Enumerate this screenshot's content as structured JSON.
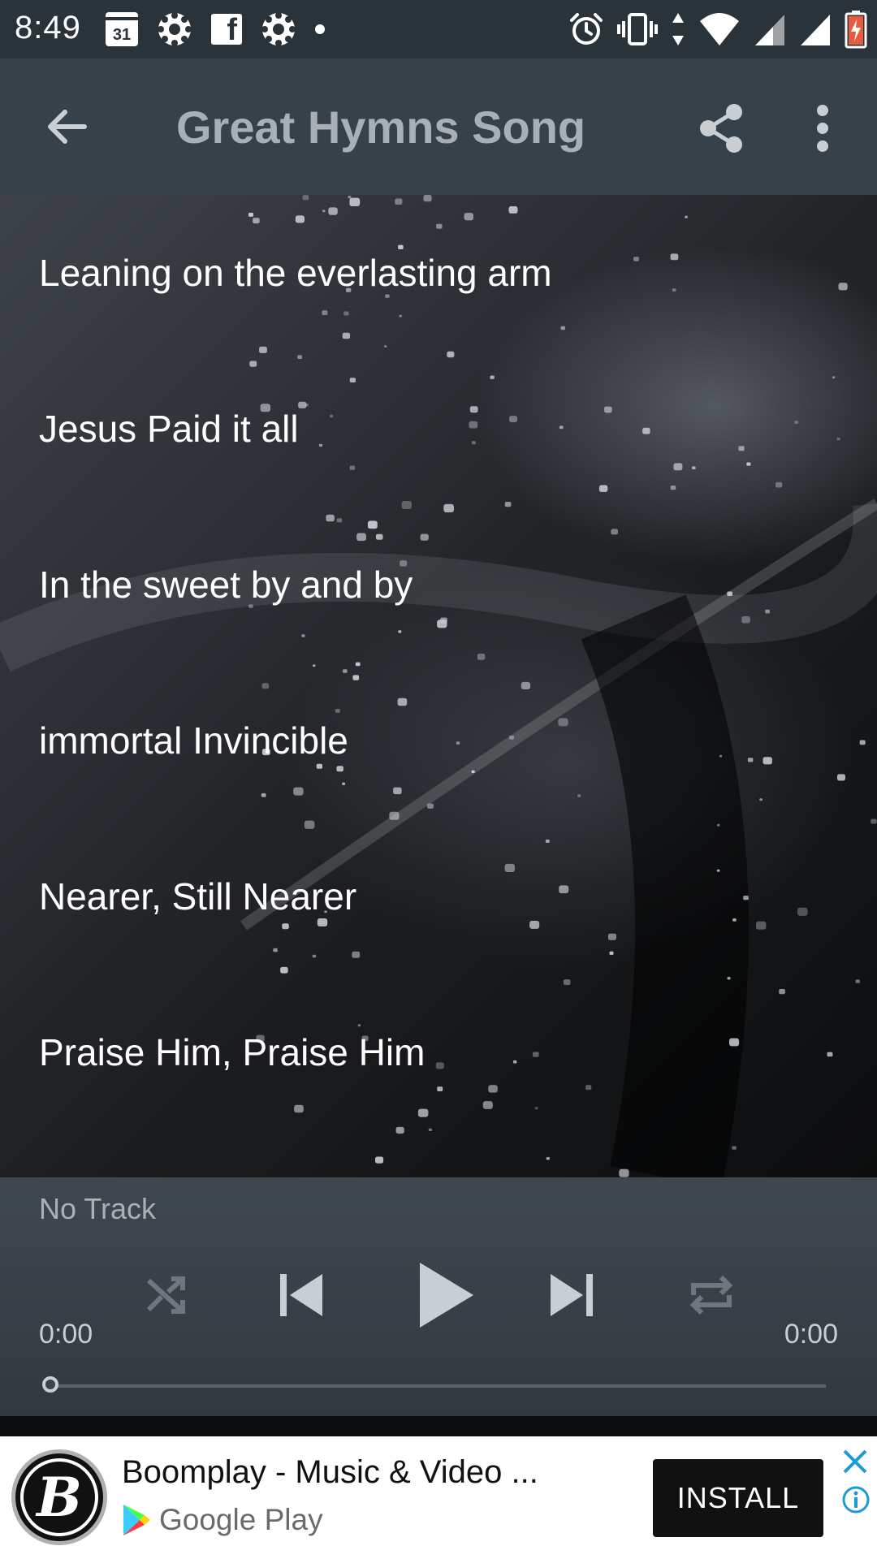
{
  "status_bar": {
    "time": "8:49",
    "calendar_day": "31",
    "left_icons": [
      "calendar-icon",
      "settings-gear-icon",
      "facebook-icon",
      "settings-gear-icon",
      "dot-icon"
    ],
    "right_icons": [
      "alarm-icon",
      "vibrate-icon",
      "data-arrows-icon",
      "wifi-icon",
      "signal-icon",
      "signal-icon",
      "battery-charging-icon"
    ],
    "battery_color": "#e85b3c"
  },
  "app_bar": {
    "title": "Great Hymns Song",
    "back_icon": "arrow-back-icon",
    "share_icon": "share-icon",
    "menu_icon": "more-vert-icon",
    "background": "#36414a",
    "title_color": "#a9b0b5"
  },
  "songs": [
    {
      "title": "Leaning on the everlasting arm"
    },
    {
      "title": "Jesus Paid it all"
    },
    {
      "title": "In the sweet by and by"
    },
    {
      "title": "immortal Invincible"
    },
    {
      "title": "Nearer, Still Nearer"
    },
    {
      "title": "Praise Him, Praise Him"
    }
  ],
  "player": {
    "track_name": "No Track",
    "current_time": "0:00",
    "total_time": "0:00",
    "progress": 0,
    "controls": [
      "shuffle-icon",
      "skip-previous-icon",
      "play-icon",
      "skip-next-icon",
      "repeat-icon"
    ]
  },
  "ad": {
    "title": "Boomplay - Music & Video ...",
    "store_label": "Google Play",
    "install_label": "INSTALL",
    "logo_letter": "B",
    "accent": "#1a9bd7"
  }
}
